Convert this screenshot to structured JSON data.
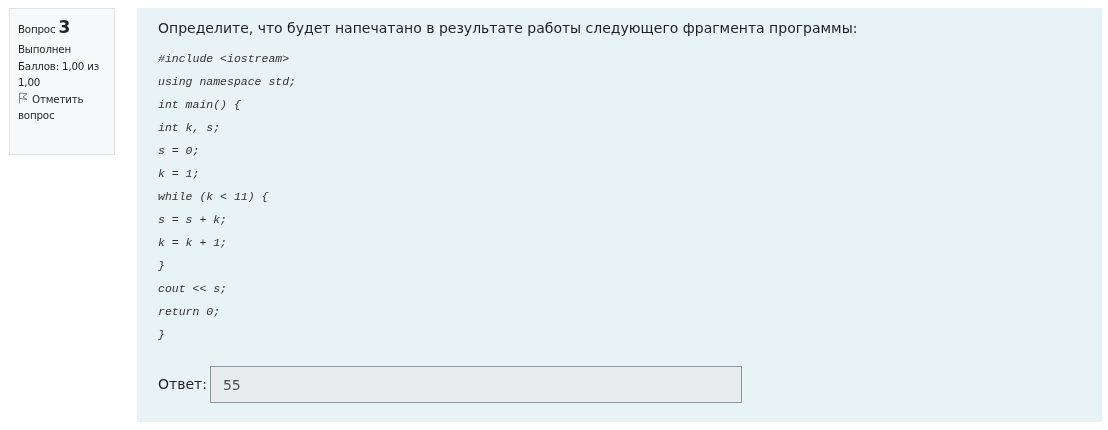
{
  "info": {
    "label": "Вопрос",
    "number": "3",
    "state": "Выполнен",
    "grade": "Баллов: 1,00 из 1,00",
    "flag": {
      "label": "Отметить вопрос",
      "flagged": false
    }
  },
  "question": {
    "text": "Определите, что будет напечатано в результате работы следующего фрагмента программы:",
    "code": [
      "#include <iostream>",
      "using namespace std;",
      "int main() {",
      "int k, s;",
      "s = 0;",
      "k = 1;",
      "while (k < 11) {",
      "s = s + k;",
      "k = k + 1;",
      "}",
      "cout << s;",
      "return 0;",
      "}"
    ]
  },
  "answer": {
    "label": "Ответ:",
    "value": "55",
    "disabled": true
  }
}
